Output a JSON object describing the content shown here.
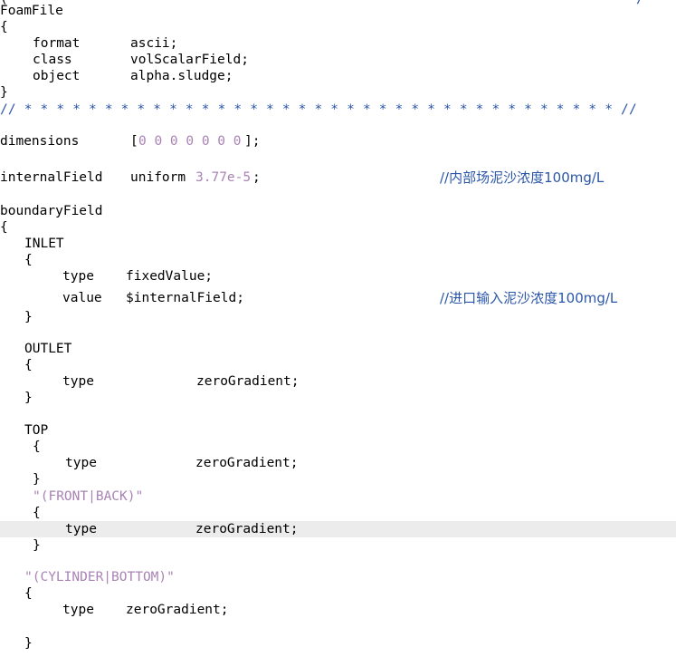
{
  "editor": {
    "highlighted_line": "type zeroGradient (FRONT|BACK)",
    "header": {
      "top_left_fragment": "(",
      "top_right_fragment": "/",
      "block_name": "FoamFile",
      "open": "{",
      "close": "}",
      "entries": [
        {
          "key": "format",
          "value": "ascii;"
        },
        {
          "key": "class",
          "value": "volScalarField;"
        },
        {
          "key": "object",
          "value": "alpha.sludge;"
        }
      ]
    },
    "separator": "// * * * * * * * * * * * * * * * * * * * * * * * * * * * * * * * * * * * * * //",
    "dimensions": {
      "key": "dimensions",
      "open": "[",
      "values": "0 0 0 0 0 0 0",
      "close": "];"
    },
    "internalField": {
      "key": "internalField",
      "kind": "uniform",
      "value": "3.77e-5",
      "terminator": ";",
      "comment": "//内部场泥沙浓度100mg/L"
    },
    "boundaryField": {
      "key": "boundaryField",
      "open": "{",
      "patches": [
        {
          "name": "INLET",
          "open": "{",
          "close": "}",
          "entries": [
            {
              "key": "type",
              "value": "fixedValue;"
            },
            {
              "key": "value",
              "value": "$internalField;",
              "comment": "//进口输入泥沙浓度100mg/L"
            }
          ]
        },
        {
          "name": "OUTLET",
          "open": "{",
          "close": "}",
          "entries": [
            {
              "key": "type",
              "value": "zeroGradient;"
            }
          ]
        },
        {
          "name": "TOP",
          "open": "{",
          "close": "}",
          "entries": [
            {
              "key": "type",
              "value": "zeroGradient;"
            }
          ]
        },
        {
          "name": "\"(FRONT|BACK)\"",
          "open": "{",
          "close": "}",
          "entries": [
            {
              "key": "type",
              "value": "zeroGradient;"
            }
          ]
        },
        {
          "name": "\"(CYLINDER|BOTTOM)\"",
          "open": "{",
          "close": "}",
          "entries": [
            {
              "key": "type",
              "value": "zeroGradient;"
            }
          ]
        }
      ]
    }
  }
}
